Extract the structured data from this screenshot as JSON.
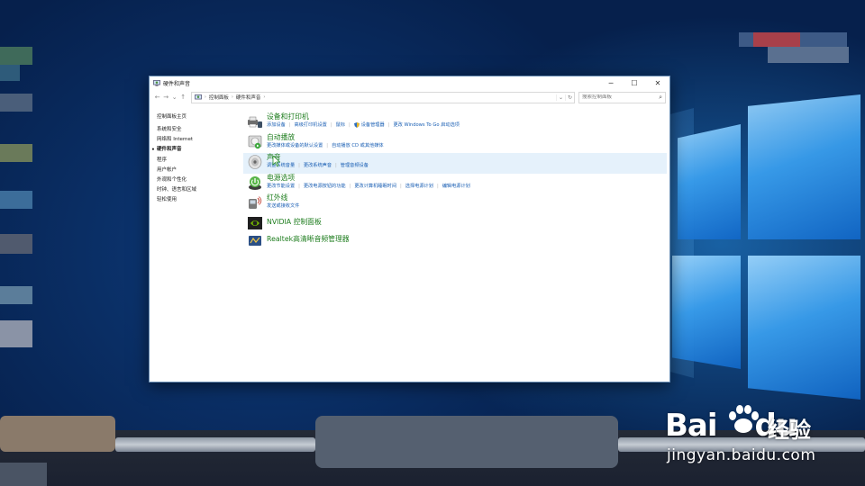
{
  "window": {
    "title": "硬件和声音",
    "controls": {
      "minimize": "─",
      "maximize": "☐",
      "close": "✕"
    }
  },
  "navigation": {
    "back": "←",
    "forward": "→",
    "recent": "⌄",
    "up": "↑",
    "breadcrumbs": [
      "控制面板",
      "硬件和声音"
    ],
    "separator": "›",
    "dropdown": "⌄",
    "refresh": "↻",
    "search_placeholder": "搜索控制面板",
    "search_icon": "⌕"
  },
  "sidebar": {
    "home": "控制面板主页",
    "items": [
      {
        "label": "系统和安全",
        "current": false
      },
      {
        "label": "网络和 Internet",
        "current": false
      },
      {
        "label": "硬件和声音",
        "current": true
      },
      {
        "label": "程序",
        "current": false
      },
      {
        "label": "用户帐户",
        "current": false
      },
      {
        "label": "外观和个性化",
        "current": false
      },
      {
        "label": "时钟、语言和区域",
        "current": false
      },
      {
        "label": "轻松使用",
        "current": false
      }
    ]
  },
  "categories": [
    {
      "title": "设备和打印机",
      "icon": "devices-printers-icon",
      "links": [
        "添加设备",
        "高级打印机设置",
        "鼠标",
        "设备管理器",
        "更改 Windows To Go 启动选项"
      ]
    },
    {
      "title": "自动播放",
      "icon": "autoplay-icon",
      "links": [
        "更改媒体或设备的默认设置",
        "自动播放 CD 或其他媒体"
      ]
    },
    {
      "title": "声音",
      "icon": "speaker-icon",
      "links": [
        "调整系统音量",
        "更改系统声音",
        "管理音频设备"
      ]
    },
    {
      "title": "电源选项",
      "icon": "power-options-icon",
      "links": [
        "更改节能设置",
        "更改电源按钮的功能",
        "更改计算机睡眠时间",
        "选择电源计划",
        "编辑电源计划"
      ]
    },
    {
      "title": "红外线",
      "icon": "infrared-icon",
      "links": [
        "发送或接收文件"
      ]
    },
    {
      "title": "NVIDIA 控制面板",
      "icon": "nvidia-icon",
      "links": []
    },
    {
      "title": "Realtek高清晰音频管理器",
      "icon": "realtek-audio-icon",
      "links": []
    }
  ],
  "watermark": {
    "logo": "Bai",
    "logo_suffix": "du",
    "label": "经验",
    "url": "jingyan.baidu.com"
  },
  "colors": {
    "link": "#1a5fb4",
    "category_title": "#1e7d1e",
    "hover_row": "#e5f1fb"
  }
}
